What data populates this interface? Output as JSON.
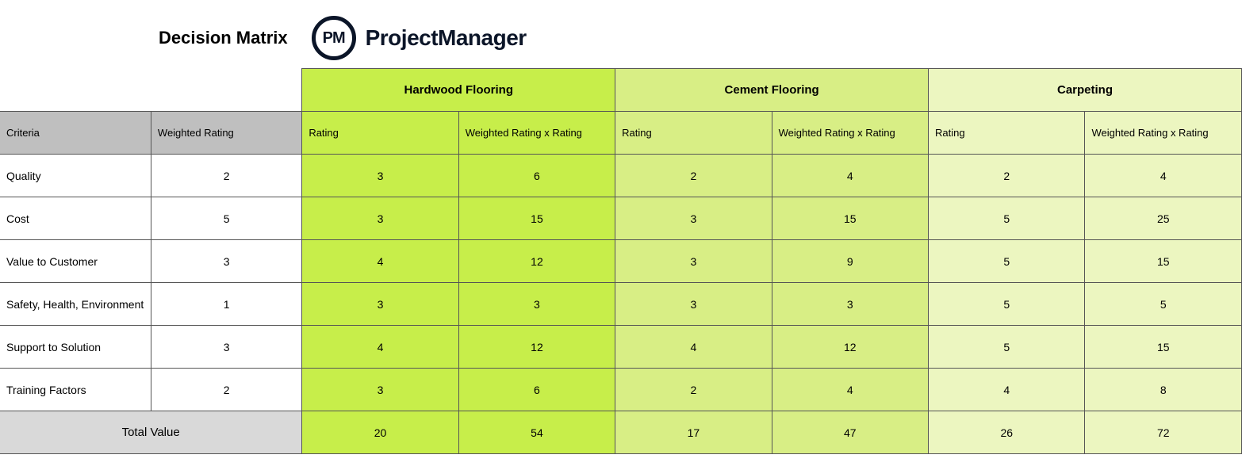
{
  "title": "Decision Matrix",
  "brand": {
    "short": "PM",
    "name": "ProjectManager"
  },
  "columns": {
    "criteria": "Criteria",
    "weighted": "Weighted Rating",
    "rating": "Rating",
    "wxr": "Weighted Rating x Rating"
  },
  "alternatives": [
    {
      "name": "Hardwood Flooring"
    },
    {
      "name": "Cement Flooring"
    },
    {
      "name": "Carpeting"
    }
  ],
  "rows": [
    {
      "criteria": "Quality",
      "weight": "2",
      "v": [
        "3",
        "6",
        "2",
        "4",
        "2",
        "4"
      ]
    },
    {
      "criteria": "Cost",
      "weight": "5",
      "v": [
        "3",
        "15",
        "3",
        "15",
        "5",
        "25"
      ]
    },
    {
      "criteria": "Value to Customer",
      "weight": "3",
      "v": [
        "4",
        "12",
        "3",
        "9",
        "5",
        "15"
      ]
    },
    {
      "criteria": "Safety, Health, Environment",
      "weight": "1",
      "v": [
        "3",
        "3",
        "3",
        "3",
        "5",
        "5"
      ]
    },
    {
      "criteria": "Support to Solution",
      "weight": "3",
      "v": [
        "4",
        "12",
        "4",
        "12",
        "5",
        "15"
      ]
    },
    {
      "criteria": "Training Factors",
      "weight": "2",
      "v": [
        "3",
        "6",
        "2",
        "4",
        "4",
        "8"
      ]
    }
  ],
  "total": {
    "label": "Total Value",
    "v": [
      "20",
      "54",
      "17",
      "47",
      "26",
      "72"
    ]
  }
}
